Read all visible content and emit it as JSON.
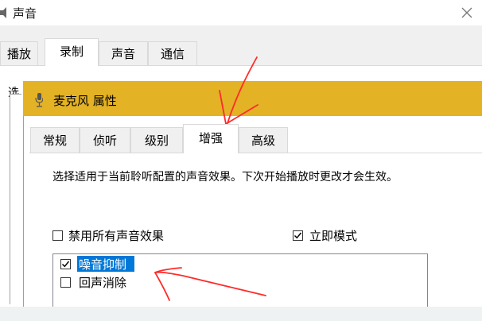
{
  "sound_window": {
    "title": "声音",
    "close_label": "×",
    "tabs": [
      {
        "label": "播放",
        "active": false
      },
      {
        "label": "录制",
        "active": true
      },
      {
        "label": "声音",
        "active": false
      },
      {
        "label": "通信",
        "active": false
      }
    ],
    "select_text_partial": "选"
  },
  "props_window": {
    "title": "麦克风 属性",
    "tabs": [
      {
        "label": "常规",
        "active": false
      },
      {
        "label": "侦听",
        "active": false
      },
      {
        "label": "级别",
        "active": false
      },
      {
        "label": "增强",
        "active": true
      },
      {
        "label": "高级",
        "active": false
      }
    ],
    "description": "选择适用于当前聆听配置的声音效果。下次开始播放时更改才会生效。",
    "disable_all": {
      "label": "禁用所有声音效果",
      "checked": false
    },
    "immediate_mode": {
      "label": "立即模式",
      "checked": true
    },
    "effects": [
      {
        "label": "噪音抑制",
        "checked": true,
        "selected": true
      },
      {
        "label": "回声消除",
        "checked": false,
        "selected": false
      }
    ]
  },
  "colors": {
    "titlebar_active": "#e3b225",
    "selection": "#0078d7",
    "annotation": "#ff2a2a"
  }
}
